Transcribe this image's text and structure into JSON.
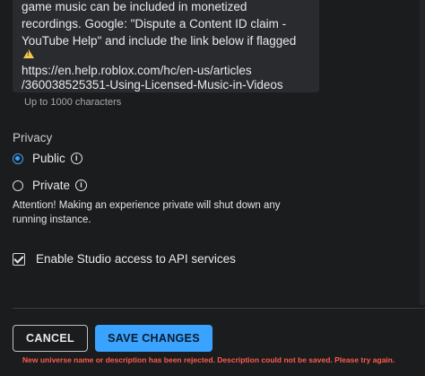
{
  "description_field": {
    "lines": [
      "game music can be included in monetized",
      "recordings. Google: \"Dispute a Content ID claim -",
      "YouTube Help\" and include the link below if flagged",
      "https://en.help.roblox.com/hc/en-us/articles",
      "/360038525351-Using-Licensed-Music-in-Videos"
    ],
    "warning_icon": "warning-triangle-icon",
    "hint": "Up to 1000 characters"
  },
  "privacy": {
    "label": "Privacy",
    "options": [
      {
        "label": "Public",
        "selected": true
      },
      {
        "label": "Private",
        "selected": false
      }
    ],
    "attention": "Attention! Making an experience private will shut down any running instance."
  },
  "studio_access": {
    "label": "Enable Studio access to API services",
    "checked": true
  },
  "actions": {
    "cancel_label": "CANCEL",
    "save_label": "SAVE CHANGES"
  },
  "error_message": "New universe name or description has been rejected. Description could not be saved. Please try again.",
  "colors": {
    "background": "#1b1c1e",
    "accent": "#3aa3ff",
    "error": "#ff5b4d",
    "field": "#2a2b2e"
  }
}
